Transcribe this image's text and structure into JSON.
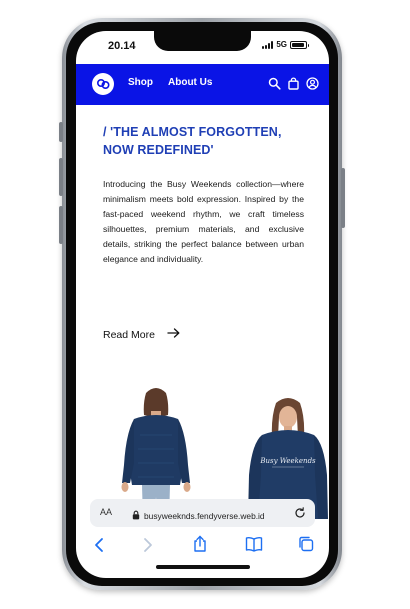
{
  "status_bar": {
    "time": "20.14",
    "network": "5G",
    "battery_level": 0.9
  },
  "nav": {
    "links": [
      {
        "label": "Shop"
      },
      {
        "label": "About Us"
      }
    ],
    "icons": [
      "search-icon",
      "bag-icon",
      "account-icon"
    ],
    "background": "#0a14e6"
  },
  "hero": {
    "headline": "/ 'THE ALMOST FORGOTTEN, NOW REDEFINED'",
    "body": "Introducing the Busy Weekends collection—where minimalism meets bold expression. Inspired by the fast-paced weekend rhythm, we craft timeless silhouettes, premium materials, and exclusive details, striking the perfect balance between urban elegance and individuality.",
    "cta_label": "Read More",
    "headline_color": "#1f3fb5"
  },
  "products": [
    {
      "name": "sweatshirt-back-view"
    },
    {
      "name": "sweatshirt-front-view",
      "print_text": "Busy Weekends"
    }
  ],
  "browser": {
    "aa_label": "AA",
    "url": "busyweeknds.fendyverse.web.id",
    "toolbar_icons": [
      "back-icon",
      "forward-icon",
      "share-icon",
      "bookmarks-icon",
      "tabs-icon"
    ]
  }
}
